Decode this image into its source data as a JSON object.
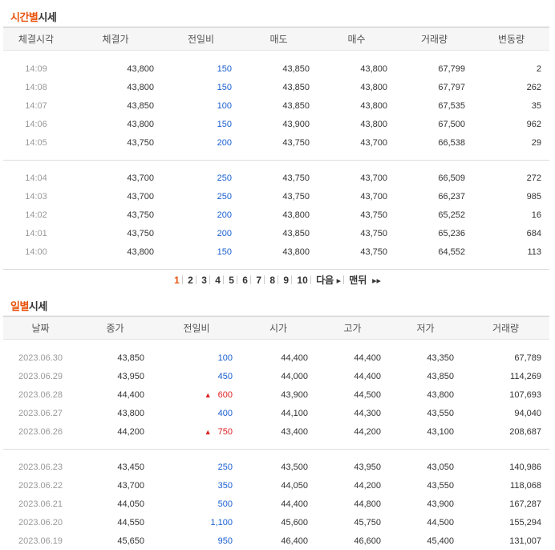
{
  "time_section": {
    "title_highlight": "시간별",
    "title_rest": "시세",
    "headers": [
      "체결시각",
      "체결가",
      "전일비",
      "매도",
      "매수",
      "거래량",
      "변동량"
    ],
    "groups": [
      [
        [
          "14:09",
          "43,800",
          "dn",
          "150",
          "43,850",
          "43,800",
          "67,799",
          "2"
        ],
        [
          "14:08",
          "43,800",
          "dn",
          "150",
          "43,850",
          "43,800",
          "67,797",
          "262"
        ],
        [
          "14:07",
          "43,850",
          "dn",
          "100",
          "43,850",
          "43,800",
          "67,535",
          "35"
        ],
        [
          "14:06",
          "43,800",
          "dn",
          "150",
          "43,900",
          "43,800",
          "67,500",
          "962"
        ],
        [
          "14:05",
          "43,750",
          "dn",
          "200",
          "43,750",
          "43,700",
          "66,538",
          "29"
        ]
      ],
      [
        [
          "14:04",
          "43,700",
          "dn",
          "250",
          "43,750",
          "43,700",
          "66,509",
          "272"
        ],
        [
          "14:03",
          "43,700",
          "dn",
          "250",
          "43,750",
          "43,700",
          "66,237",
          "985"
        ],
        [
          "14:02",
          "43,750",
          "dn",
          "200",
          "43,800",
          "43,750",
          "65,252",
          "16"
        ],
        [
          "14:01",
          "43,750",
          "dn",
          "200",
          "43,850",
          "43,750",
          "65,236",
          "684"
        ],
        [
          "14:00",
          "43,800",
          "dn",
          "150",
          "43,800",
          "43,750",
          "64,552",
          "113"
        ]
      ]
    ]
  },
  "pagination": {
    "pages": [
      "1",
      "2",
      "3",
      "4",
      "5",
      "6",
      "7",
      "8",
      "9",
      "10"
    ],
    "current": "1",
    "next_label": "다음",
    "next_icon": "▶",
    "last_label": "맨뒤",
    "last_icon": "▶▶"
  },
  "daily_section": {
    "title_highlight": "일별",
    "title_rest": "시세",
    "headers": [
      "날짜",
      "종가",
      "전일비",
      "시가",
      "고가",
      "저가",
      "거래량"
    ],
    "groups": [
      [
        [
          "2023.06.30",
          "43,850",
          "dn",
          "100",
          "44,400",
          "44,400",
          "43,350",
          "67,789"
        ],
        [
          "2023.06.29",
          "43,950",
          "dn",
          "450",
          "44,000",
          "44,400",
          "43,850",
          "114,269"
        ],
        [
          "2023.06.28",
          "44,400",
          "up",
          "600",
          "43,900",
          "44,500",
          "43,800",
          "107,693"
        ],
        [
          "2023.06.27",
          "43,800",
          "dn",
          "400",
          "44,100",
          "44,300",
          "43,550",
          "94,040"
        ],
        [
          "2023.06.26",
          "44,200",
          "up",
          "750",
          "43,400",
          "44,200",
          "43,100",
          "208,687"
        ]
      ],
      [
        [
          "2023.06.23",
          "43,450",
          "dn",
          "250",
          "43,500",
          "43,950",
          "43,050",
          "140,986"
        ],
        [
          "2023.06.22",
          "43,700",
          "dn",
          "350",
          "44,050",
          "44,200",
          "43,550",
          "118,068"
        ],
        [
          "2023.06.21",
          "44,050",
          "dn",
          "500",
          "44,400",
          "44,800",
          "43,900",
          "167,287"
        ],
        [
          "2023.06.20",
          "44,550",
          "dn",
          "1,100",
          "45,600",
          "45,750",
          "44,500",
          "155,294"
        ],
        [
          "2023.06.19",
          "45,650",
          "dn",
          "950",
          "46,400",
          "46,600",
          "45,400",
          "131,007"
        ]
      ]
    ]
  },
  "colors": {
    "accent": "#e8520c",
    "down": "#1a5fd0",
    "up": "#dd2222"
  },
  "icons": {
    "down": "▼",
    "up": "▲"
  }
}
